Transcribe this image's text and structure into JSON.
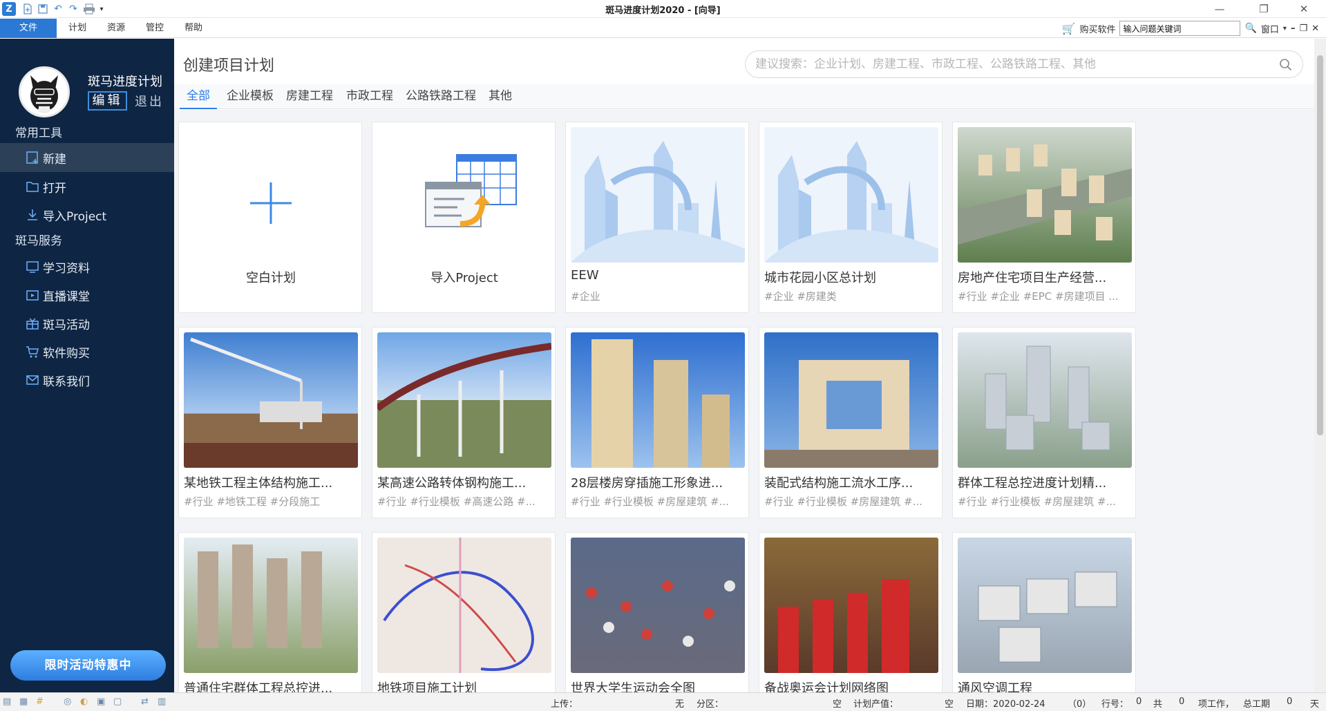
{
  "window": {
    "title": "斑马进度计划2020 - [向导]",
    "logo": "Z"
  },
  "menubar": {
    "items": [
      "文件",
      "计划",
      "资源",
      "管控",
      "帮助"
    ],
    "buy": "购买软件",
    "help_search_value": "输入问题关键词",
    "window_menu": "窗口"
  },
  "sidebar": {
    "brand": "斑马进度计划",
    "edit": "编辑",
    "logout": "退出",
    "section_tools": "常用工具",
    "tools": [
      "新建",
      "打开",
      "导入Project"
    ],
    "section_services": "斑马服务",
    "services": [
      "学习资料",
      "直播课堂",
      "斑马活动",
      "软件购买",
      "联系我们"
    ],
    "promo": "限时活动特惠中"
  },
  "main": {
    "title": "创建项目计划",
    "search_placeholder": "建议搜索：企业计划、房建工程、市政工程、公路铁路工程、其他",
    "tabs": [
      "全部",
      "企业模板",
      "房建工程",
      "市政工程",
      "公路铁路工程",
      "其他"
    ],
    "cards": [
      {
        "title": "空白计划",
        "tags": ""
      },
      {
        "title": "导入Project",
        "tags": ""
      },
      {
        "title": "EEW",
        "tags": "#企业"
      },
      {
        "title": "城市花园小区总计划",
        "tags": "#企业 #房建类"
      },
      {
        "title": "房地产住宅项目生产经营...",
        "tags": "#行业 #企业 #EPC #房建项目 ..."
      },
      {
        "title": "某地铁工程主体结构施工...",
        "tags": "#行业 #地铁工程 #分段施工"
      },
      {
        "title": "某高速公路转体钢构施工...",
        "tags": "#行业 #行业模板 #高速公路 #..."
      },
      {
        "title": "28层楼房穿插施工形象进...",
        "tags": "#行业 #行业模板 #房屋建筑 #..."
      },
      {
        "title": "装配式结构施工流水工序...",
        "tags": "#行业 #行业模板 #房屋建筑 #..."
      },
      {
        "title": "群体工程总控进度计划精...",
        "tags": "#行业 #行业模板 #房屋建筑 #..."
      },
      {
        "title": "普通住宅群体工程总控进...",
        "tags": ""
      },
      {
        "title": "地铁项目施工计划",
        "tags": ""
      },
      {
        "title": "世界大学生运动会全图",
        "tags": ""
      },
      {
        "title": "备战奥运会计划网络图",
        "tags": ""
      },
      {
        "title": "通风空调工程",
        "tags": ""
      }
    ]
  },
  "statusbar": {
    "upload_label": "上传：",
    "upload_value": "无",
    "area_label": "分区：",
    "area_value": "空",
    "output_label": "计划产值：",
    "output_value": "空",
    "date": "日期：2020-02-24",
    "count": "（0）",
    "row_label": "行号：",
    "row_value": "0",
    "total_label": "共",
    "total_value": "0",
    "work_label": "项工作，",
    "duration_label": "总工期",
    "duration_value": "0",
    "unit": "天"
  },
  "colors": {
    "accent": "#2b7de9",
    "sidebar": "#0e2543",
    "menu_file": "#2b79d5"
  }
}
